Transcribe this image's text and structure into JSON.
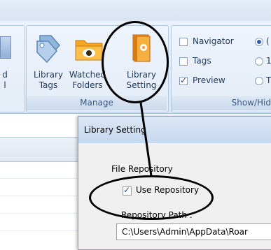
{
  "ribbon": {
    "left_partial_labels": [
      "d",
      "l"
    ],
    "buttons": [
      {
        "label_line1": "Library",
        "label_line2": "Tags",
        "icon": "tags-icon"
      },
      {
        "label_line1": "Watched",
        "label_line2": "Folders",
        "icon": "folder-icon"
      },
      {
        "label_line1": "Library",
        "label_line2": "Setting",
        "icon": "library-setting-icon"
      }
    ],
    "group_caption": "Manage",
    "show_hide": {
      "caption": "Show/Hid",
      "items": [
        {
          "label": "Navigator",
          "checked": false
        },
        {
          "label": "Tags",
          "checked": false
        },
        {
          "label": "Preview",
          "checked": true
        }
      ],
      "radios": [
        {
          "selected": true,
          "label": "("
        },
        {
          "selected": false,
          "label": "1"
        },
        {
          "selected": false,
          "label": "T"
        }
      ]
    }
  },
  "dialog": {
    "title": "Library Setting",
    "section_label": "File Repository",
    "use_repository_label": "Use Repository",
    "use_repository_checked": true,
    "path_label": "Repository Path :",
    "path_value": "C:\\Users\\Admin\\AppData\\Roar"
  }
}
